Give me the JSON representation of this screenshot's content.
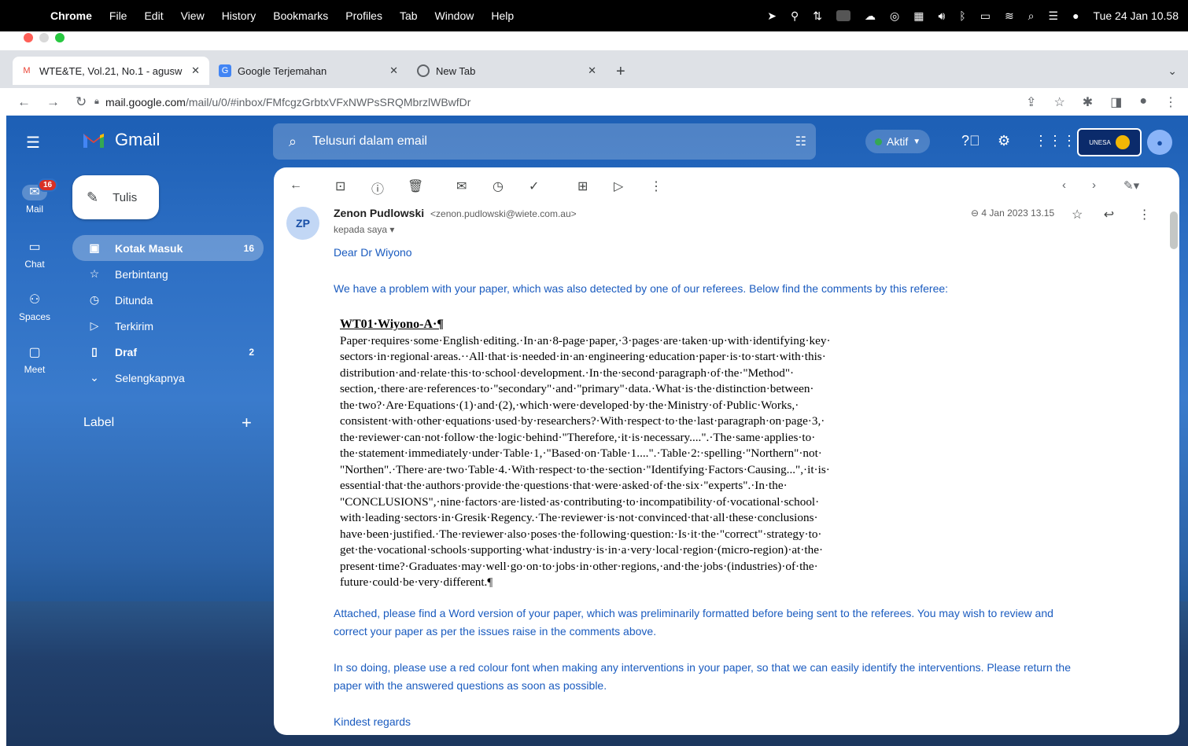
{
  "mac_menubar": {
    "app": "Chrome",
    "menus": [
      "File",
      "Edit",
      "View",
      "History",
      "Bookmarks",
      "Profiles",
      "Tab",
      "Window",
      "Help"
    ],
    "datetime": "Tue 24 Jan  10.58"
  },
  "browser": {
    "tabs": [
      {
        "title": "WTE&TE, Vol.21, No.1 - agusw",
        "favicon": "gmail-icon",
        "active": true
      },
      {
        "title": "Google Terjemahan",
        "favicon": "translate-icon",
        "active": false
      },
      {
        "title": "New Tab",
        "favicon": "chrome-icon",
        "active": false
      }
    ],
    "url_host": "mail.google.com",
    "url_path": "/mail/u/0/#inbox/FMfcgzGrbtxVFxNWPsSRQMbrzlWBwfDr"
  },
  "gmail": {
    "brand": "Gmail",
    "search_placeholder": "Telusuri dalam email",
    "status": "Aktif",
    "rail": [
      {
        "label": "Mail",
        "icon": "mail-icon",
        "badge": "16"
      },
      {
        "label": "Chat",
        "icon": "chat-icon"
      },
      {
        "label": "Spaces",
        "icon": "spaces-icon"
      },
      {
        "label": "Meet",
        "icon": "meet-icon"
      }
    ],
    "compose_label": "Tulis",
    "nav": [
      {
        "label": "Kotak Masuk",
        "icon": "inbox-icon",
        "count": "16",
        "selected": true
      },
      {
        "label": "Berbintang",
        "icon": "star-icon",
        "count": ""
      },
      {
        "label": "Ditunda",
        "icon": "clock-icon",
        "count": ""
      },
      {
        "label": "Terkirim",
        "icon": "send-icon",
        "count": ""
      },
      {
        "label": "Draf",
        "icon": "draft-icon",
        "count": "2",
        "bold": true
      },
      {
        "label": "Selengkapnya",
        "icon": "chevron-down-icon",
        "count": ""
      }
    ],
    "labels_heading": "Label",
    "org_badge": "UNESA",
    "message": {
      "sender_name": "Zenon Pudlowski",
      "sender_email": "<zenon.pudlowski@wiete.com.au>",
      "to": "kepada saya",
      "date": "4 Jan 2023 13.15",
      "greeting": "Dear Dr Wiyono",
      "intro": "We have a problem with your paper, which was also detected by one of our referees. Below find the comments by this referee:",
      "quote_title": "WT01·Wiyono-A·¶",
      "quote_lines": [
        "Paper·requires·some·English·editing.·In·an·8-page·paper,·3·pages·are·taken·up·with·identifying·key·",
        "sectors·in·regional·areas.··All·that·is·needed·in·an·engineering·education·paper·is·to·start·with·this·",
        "distribution·and·relate·this·to·school·development.·In·the·second·paragraph·of·the·\"Method\"·",
        "section,·there·are·references·to·\"secondary\"·and·\"primary\"·data.·What·is·the·distinction·between·",
        "the·two?·Are·Equations·(1)·and·(2),·which·were·developed·by·the·Ministry·of·Public·Works,·",
        "consistent·with·other·equations·used·by·researchers?·With·respect·to·the·last·paragraph·on·page·3,·",
        "the·reviewer·can·not·follow·the·logic·behind·\"Therefore,·it·is·necessary....\".·The·same·applies·to·",
        "the·statement·immediately·under·Table·1,·\"Based·on·Table·1....\".·Table·2:·spelling·\"Northern\"·not·",
        "\"Northen\".·There·are·two·Table·4.·With·respect·to·the·section·\"Identifying·Factors·Causing...\",·it·is·",
        "essential·that·the·authors·provide·the·questions·that·were·asked·of·the·six·\"experts\".·In·the·",
        "\"CONCLUSIONS\",·nine·factors·are·listed·as·contributing·to·incompatibility·of·vocational·school·",
        "with·leading·sectors·in·Gresik·Regency.·The·reviewer·is·not·convinced·that·all·these·conclusions·",
        "have·been·justified.·The·reviewer·also·poses·the·following·question:·Is·it·the·\"correct\"·strategy·to·",
        "get·the·vocational·schools·supporting·what·industry·is·in·a·very·local·region·(micro-region)·at·the·",
        "present·time?·Graduates·may·well·go·on·to·jobs·in·other·regions,·and·the·jobs·(industries)·of·the·",
        "future·could·be·very·different.¶"
      ],
      "para2_line1": "Attached, please find a Word version of your paper, which was preliminarily formatted before being sent to the referees. You may wish to review and",
      "para2_line2": "correct your paper as per the issues raise in the comments above.",
      "para3_line1": "In so doing, please use a red colour font when making any interventions in your paper, so that we can easily identify the interventions. Please return the",
      "para3_line2": "paper with the answered questions as soon as possible.",
      "closing": "Kindest regards"
    }
  },
  "colors": {
    "accent_blue": "#1a5bbf",
    "badge_red": "#d93025",
    "status_green": "#34a853"
  }
}
